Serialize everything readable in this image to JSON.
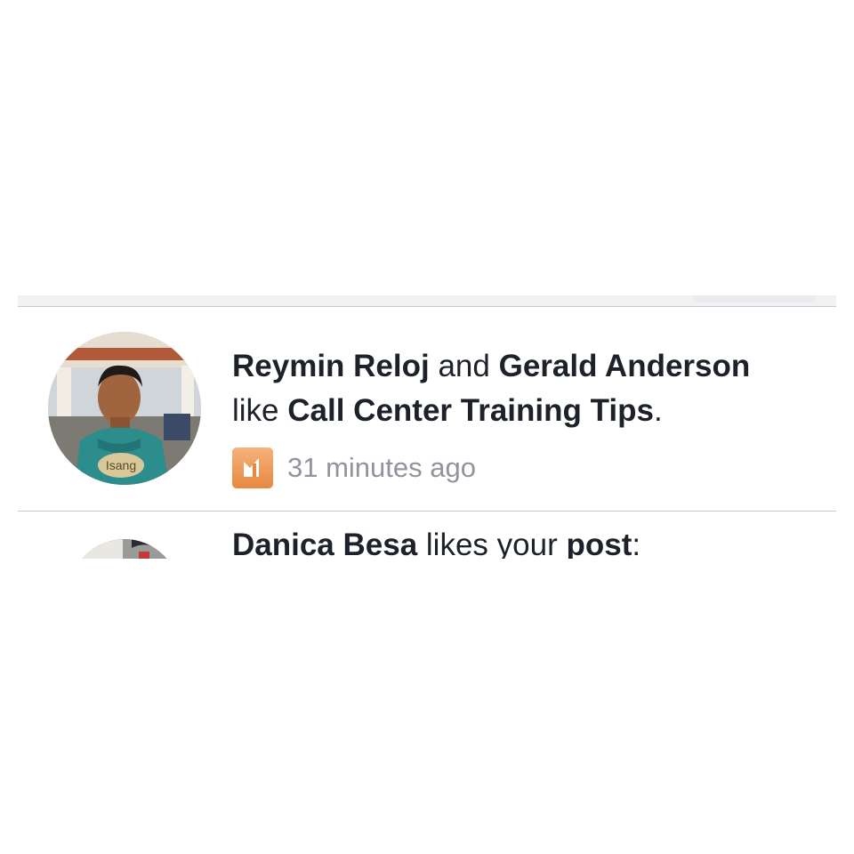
{
  "notifications": [
    {
      "actor_1": "Reymin Reloj",
      "connector": "and",
      "actor_2": "Gerald Anderson",
      "verb": "like",
      "object": "Call Center Training Tips",
      "end_punct": ".",
      "time": "31 minutes ago",
      "type_icon": "like-page-icon",
      "avatar_shirt_text": "Isang"
    },
    {
      "actor_1": "Danica Besa",
      "verb": "likes your",
      "object": "post",
      "end_punct": ":"
    }
  ],
  "colors": {
    "text_primary": "#1d2129",
    "text_secondary": "#90949c",
    "divider": "#c8ccd2",
    "badge_orange": "#e8883f"
  }
}
